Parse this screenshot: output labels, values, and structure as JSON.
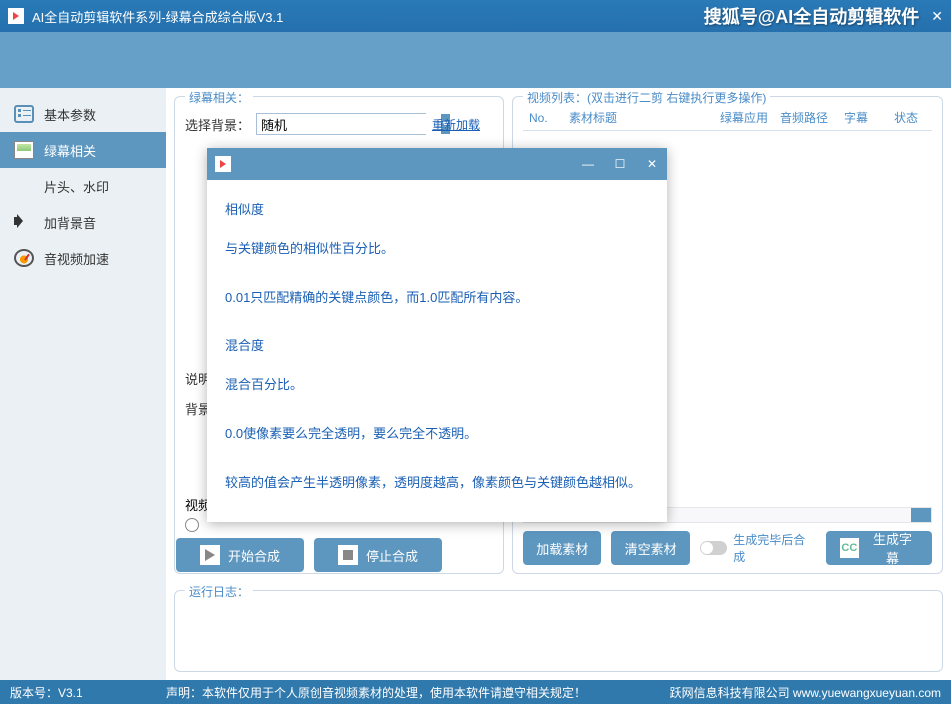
{
  "titlebar": {
    "title": "AI全自动剪辑软件系列-绿幕合成综合版V3.1",
    "watermark": "搜狐号@AI全自动剪辑软件"
  },
  "sidebar": {
    "items": [
      {
        "label": "基本参数"
      },
      {
        "label": "绿幕相关"
      },
      {
        "label": "片头、水印"
      },
      {
        "label": "加背景音"
      },
      {
        "label": "音视频加速"
      }
    ]
  },
  "greenpanel": {
    "title": "绿幕相关：",
    "bg_label": "选择背景：",
    "bg_value": "随机",
    "reload": "重新加载",
    "desc1": "说明",
    "desc2": "背景",
    "desc3": "视频"
  },
  "listpanel": {
    "title": "视频列表：(双击进行二剪 右键执行更多操作)",
    "cols": {
      "no": "No.",
      "title": "素材标题",
      "app": "绿幕应用",
      "audio": "音频路径",
      "sub": "字幕",
      "stat": "状态"
    }
  },
  "buttons": {
    "start": "开始合成",
    "stop": "停止合成",
    "load": "加载素材",
    "clear": "清空素材",
    "toggle": "生成完毕后合成",
    "gensub": "生成字幕"
  },
  "log": {
    "title": "运行日志："
  },
  "status": {
    "version": "版本号：V3.1",
    "disclaimer": "声明：本软件仅用于个人原创音视频素材的处理，使用本软件请遵守相关规定！",
    "company": "跃网信息科技有限公司  www.yuewangxueyuan.com"
  },
  "modal": {
    "p1": "相似度",
    "p2": "与关键颜色的相似性百分比。",
    "p3": "0.01只匹配精确的关键点颜色，而1.0匹配所有内容。",
    "p4": "混合度",
    "p5": "混合百分比。",
    "p6": "0.0使像素要么完全透明，要么完全不透明。",
    "p7": "较高的值会产生半透明像素，透明度越高，像素颜色与关键颜色越相似。"
  }
}
